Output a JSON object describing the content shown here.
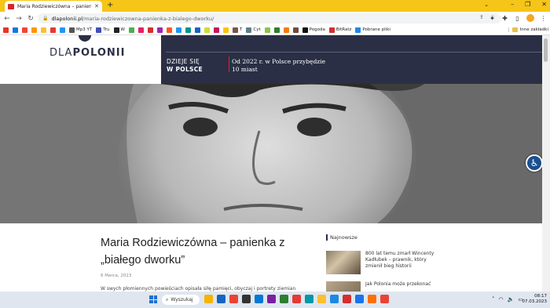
{
  "browser": {
    "tab_title": "Maria Rodziewiczówna – panien",
    "url_host": "dlapolonii.pl",
    "url_path": "/maria-rodziewiczowna-panienka-z-bialego-dworku/",
    "bookmarks": [
      {
        "label": "",
        "color": "#e8332a"
      },
      {
        "label": "",
        "color": "#1a73e8"
      },
      {
        "label": "",
        "color": "#f44336"
      },
      {
        "label": "",
        "color": "#ff9800"
      },
      {
        "label": "",
        "color": "#fbc02d"
      },
      {
        "label": "",
        "color": "#e53935"
      },
      {
        "label": "",
        "color": "#2196f3"
      },
      {
        "label": "Mp3 YT",
        "color": "#555"
      },
      {
        "label": "Tru",
        "color": "#3f51b5"
      },
      {
        "label": "W",
        "color": "#222"
      },
      {
        "label": "",
        "color": "#4caf50"
      },
      {
        "label": "",
        "color": "#e91e63"
      },
      {
        "label": "",
        "color": "#d32f2f"
      },
      {
        "label": "",
        "color": "#9c27b0"
      },
      {
        "label": "",
        "color": "#ff5722"
      },
      {
        "label": "",
        "color": "#2196f3"
      },
      {
        "label": "",
        "color": "#009688"
      },
      {
        "label": "",
        "color": "#1565c0"
      },
      {
        "label": "",
        "color": "#cddc39"
      },
      {
        "label": "",
        "color": "#c2185b"
      },
      {
        "label": "",
        "color": "#ffc107"
      },
      {
        "label": "T",
        "color": "#795548"
      },
      {
        "label": "Cyt",
        "color": "#607d8b"
      },
      {
        "label": "",
        "color": "#8bc34a"
      },
      {
        "label": "",
        "color": "#2e7d32"
      },
      {
        "label": "",
        "color": "#f57c00"
      },
      {
        "label": "",
        "color": "#6d4c41"
      },
      {
        "label": "Pogoda",
        "color": "#111"
      },
      {
        "label": "BitRatz",
        "color": "#d32f2f"
      },
      {
        "label": "Pobrane pliki",
        "color": "#1e88e5"
      }
    ],
    "other_bookmarks": "Inne zakładki"
  },
  "site": {
    "logo_light": "DLA",
    "logo_bold": "POLONII",
    "header_faint": "",
    "ticker_label_line1": "DZIEJE SIĘ",
    "ticker_label_line2": "W POLSCE",
    "ticker_text_line1": "Od 2022 r. w Polsce przybędzie",
    "ticker_text_line2": "10 miast"
  },
  "article": {
    "title": "Maria Rodziewiczówna – panienka z „białego dworku”",
    "date": "6 Marca, 2023",
    "lead": "W swych płomiennych powieściach opisała siłę pamięci, obyczaj i portrety ziemian"
  },
  "sidebar": {
    "heading": "Najnowsze",
    "items": [
      {
        "text": "800 lat temu zmarł Wincenty Kadłubek – prawnik, który zmienił bieg historii"
      },
      {
        "text": "Jak Polonia może przekonać"
      }
    ]
  },
  "taskbar": {
    "search_label": "Wyszukaj",
    "time": "08:17",
    "date": "07.03.2023",
    "apps": [
      "#f4b400",
      "#1565c0",
      "#ea4335",
      "#333",
      "#0078d4",
      "#7b1fa2",
      "#2e7d32",
      "#e53935",
      "#0097a7",
      "#fbc02d",
      "#1e88e5",
      "#d32f2f",
      "#1a73e8",
      "#ff6f00",
      "#ea4335"
    ]
  }
}
